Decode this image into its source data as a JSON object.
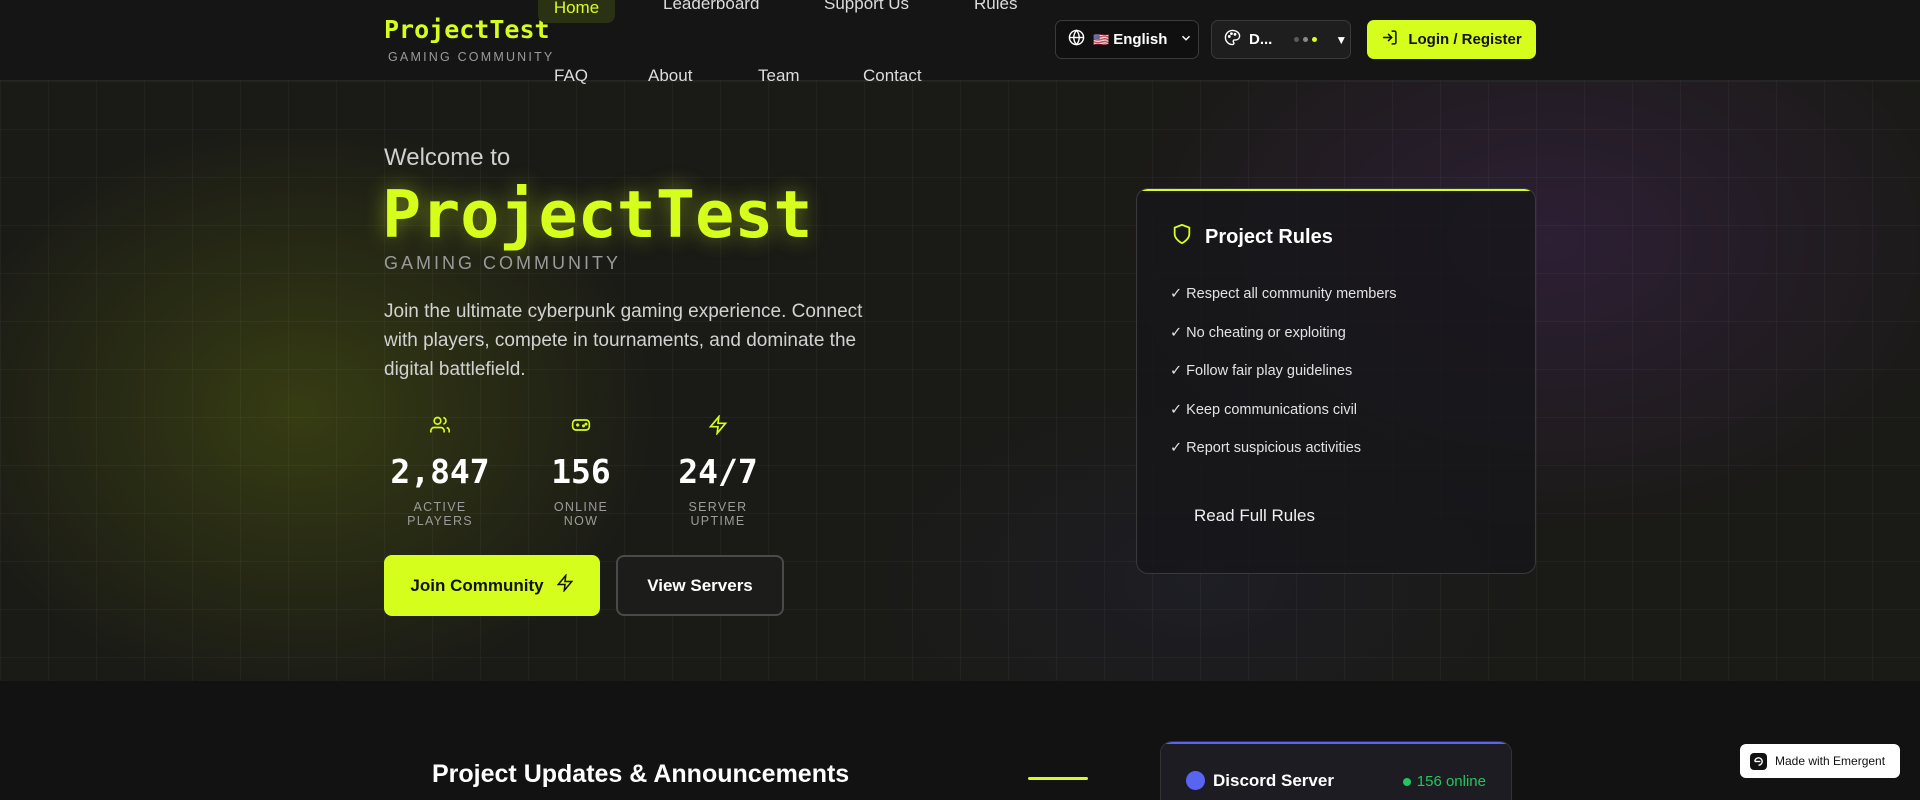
{
  "brand": {
    "name": "ProjectTest",
    "tagline": "GAMING COMMUNITY",
    "accent_color": "#d6fe1c"
  },
  "nav": {
    "items": [
      {
        "label": "Home",
        "active": true
      },
      {
        "label": "Leaderboard"
      },
      {
        "label": "Support Us"
      },
      {
        "label": "Rules"
      },
      {
        "label": "FAQ"
      },
      {
        "label": "About"
      },
      {
        "label": "Team"
      },
      {
        "label": "Contact"
      }
    ]
  },
  "header": {
    "language": {
      "flag": "🇺🇸",
      "label": "English",
      "icon": "globe-icon"
    },
    "theme": {
      "label": "D...",
      "icon": "palette-icon",
      "dot_colors": [
        "#5a5a5a",
        "#8a8a8a",
        "#d6fe1c"
      ]
    },
    "login_label": "Login / Register"
  },
  "hero": {
    "welcome": "Welcome to",
    "title": "ProjectTest",
    "subtitle": "GAMING COMMUNITY",
    "description": "Join the ultimate cyberpunk gaming experience. Connect with players, compete in tournaments, and dominate the digital battlefield.",
    "stats": [
      {
        "icon": "users-icon",
        "value": "2,847",
        "label": "ACTIVE PLAYERS"
      },
      {
        "icon": "gamepad-icon",
        "value": "156",
        "label": "ONLINE NOW"
      },
      {
        "icon": "lightning-icon",
        "value": "24/7",
        "label": "SERVER UPTIME"
      }
    ],
    "primary_button": "Join Community",
    "secondary_button": "View Servers"
  },
  "rules_card": {
    "title": "Project Rules",
    "items": [
      "✓ Respect all community members",
      "✓ No cheating or exploiting",
      "✓ Follow fair play guidelines",
      "✓ Keep communications civil",
      "✓ Report suspicious activities"
    ],
    "link": "Read Full Rules"
  },
  "updates": {
    "title": "Project Updates & Announcements"
  },
  "discord": {
    "name": "Discord Server",
    "online": "156 online",
    "brand_color": "#5865f2",
    "status_color": "#22c55e"
  },
  "badge": {
    "label": "Made with Emergent"
  }
}
